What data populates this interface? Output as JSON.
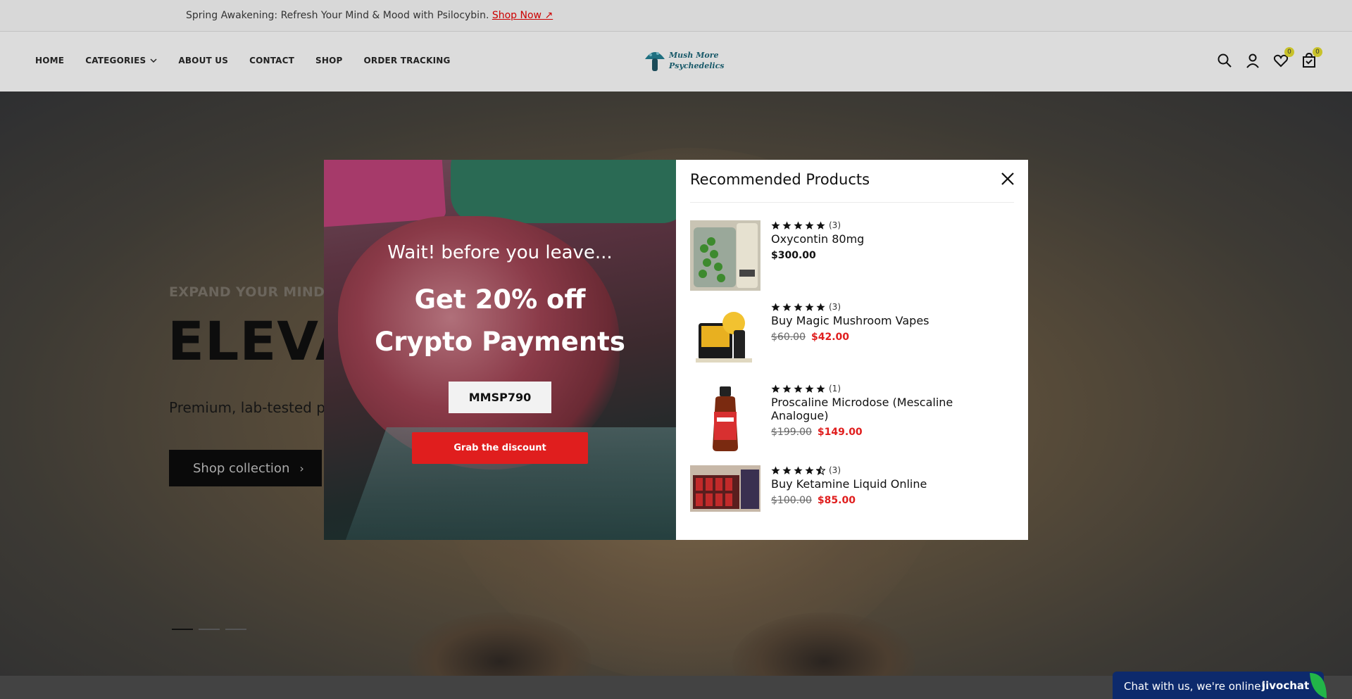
{
  "announcement": {
    "text": "Spring Awakening: Refresh Your Mind & Mood with Psilocybin.",
    "link": "Shop Now ↗"
  },
  "nav": {
    "items": [
      "HOME",
      "CATEGORIES",
      "ABOUT US",
      "CONTACT",
      "SHOP",
      "ORDER TRACKING"
    ]
  },
  "logo": {
    "line1": "Mush More",
    "line2": "Psychedelics"
  },
  "header_icons": {
    "wishlist_count": "0",
    "cart_count": "0"
  },
  "hero": {
    "tagline": "EXPAND YOUR MIND.",
    "title": "ELEVAT",
    "subtitle": "Premium, lab-tested psi",
    "button": "Shop collection",
    "slides": 3,
    "active_slide": 1
  },
  "modal": {
    "wait": "Wait! before you leave...",
    "offer": "Get 20% off",
    "offer_sub": "Crypto Payments",
    "coupon": "MMSP790",
    "cta": "Grab the discount",
    "recommended_title": "Recommended Products",
    "products": [
      {
        "name": "Oxycontin 80mg",
        "rating": 5,
        "reviews": "(3)",
        "price": "$300.00",
        "old_price": "",
        "new_price": ""
      },
      {
        "name": "Buy Magic Mushroom Vapes",
        "rating": 5,
        "reviews": "(3)",
        "price": "",
        "old_price": "$60.00",
        "new_price": "$42.00"
      },
      {
        "name": "Proscaline Microdose (Mescaline Analogue)",
        "rating": 5,
        "reviews": "(1)",
        "price": "",
        "old_price": "$199.00",
        "new_price": "$149.00"
      },
      {
        "name": "Buy Ketamine Liquid Online",
        "rating": 4.5,
        "reviews": "(3)",
        "price": "",
        "old_price": "$100.00",
        "new_price": "$85.00"
      }
    ]
  },
  "chat": {
    "text": "Chat with us, we're online!",
    "brand": "jivochat"
  },
  "colors": {
    "accent_red": "#e01e1e",
    "badge": "#c8c22a",
    "chat_bg": "#0d2a6c"
  }
}
